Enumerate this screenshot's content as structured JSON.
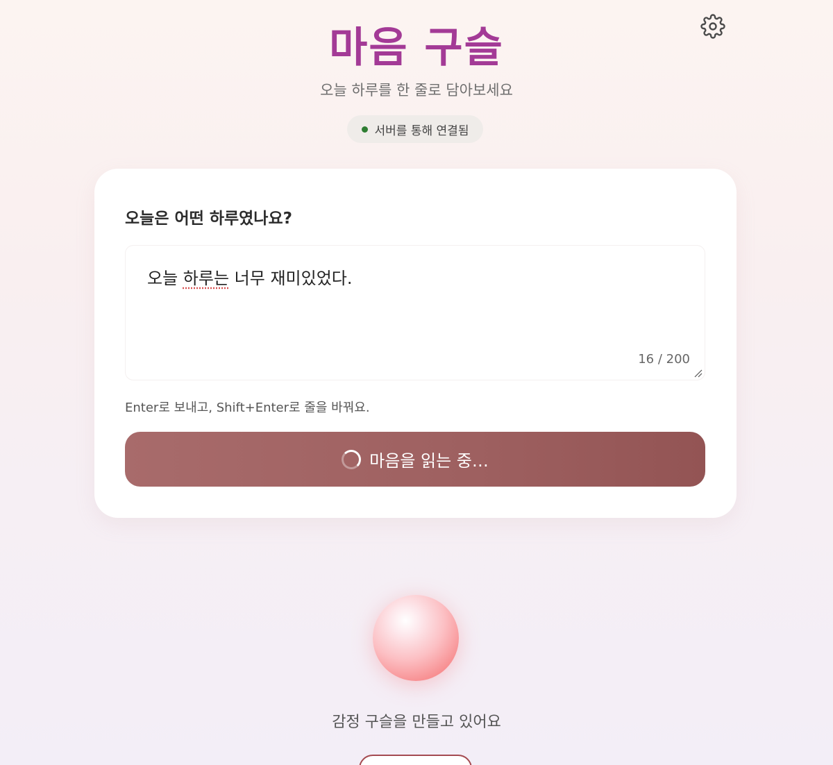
{
  "header": {
    "title": "마음 구슬",
    "subtitle": "오늘 하루를 한 줄로 담아보세요",
    "status": "서버를 통해 연결됨",
    "settings_icon": "gear-icon"
  },
  "card": {
    "question": "오늘은 어떤 하루였나요?",
    "entry": {
      "part1": "오늘 ",
      "underlined": "하루는",
      "part2": " 너무 재미있었다."
    },
    "char_count": "16 / 200",
    "hint": "Enter로 보내고, Shift+Enter로 줄을 바꿔요.",
    "submit_label": "마음을 읽는 중…"
  },
  "orb": {
    "caption": "감정 구슬을 만들고 있어요"
  },
  "colors": {
    "title": "#a33a96",
    "status_dot": "#2e7d32",
    "button": "#9e6060",
    "orb": "#f78a8c"
  }
}
